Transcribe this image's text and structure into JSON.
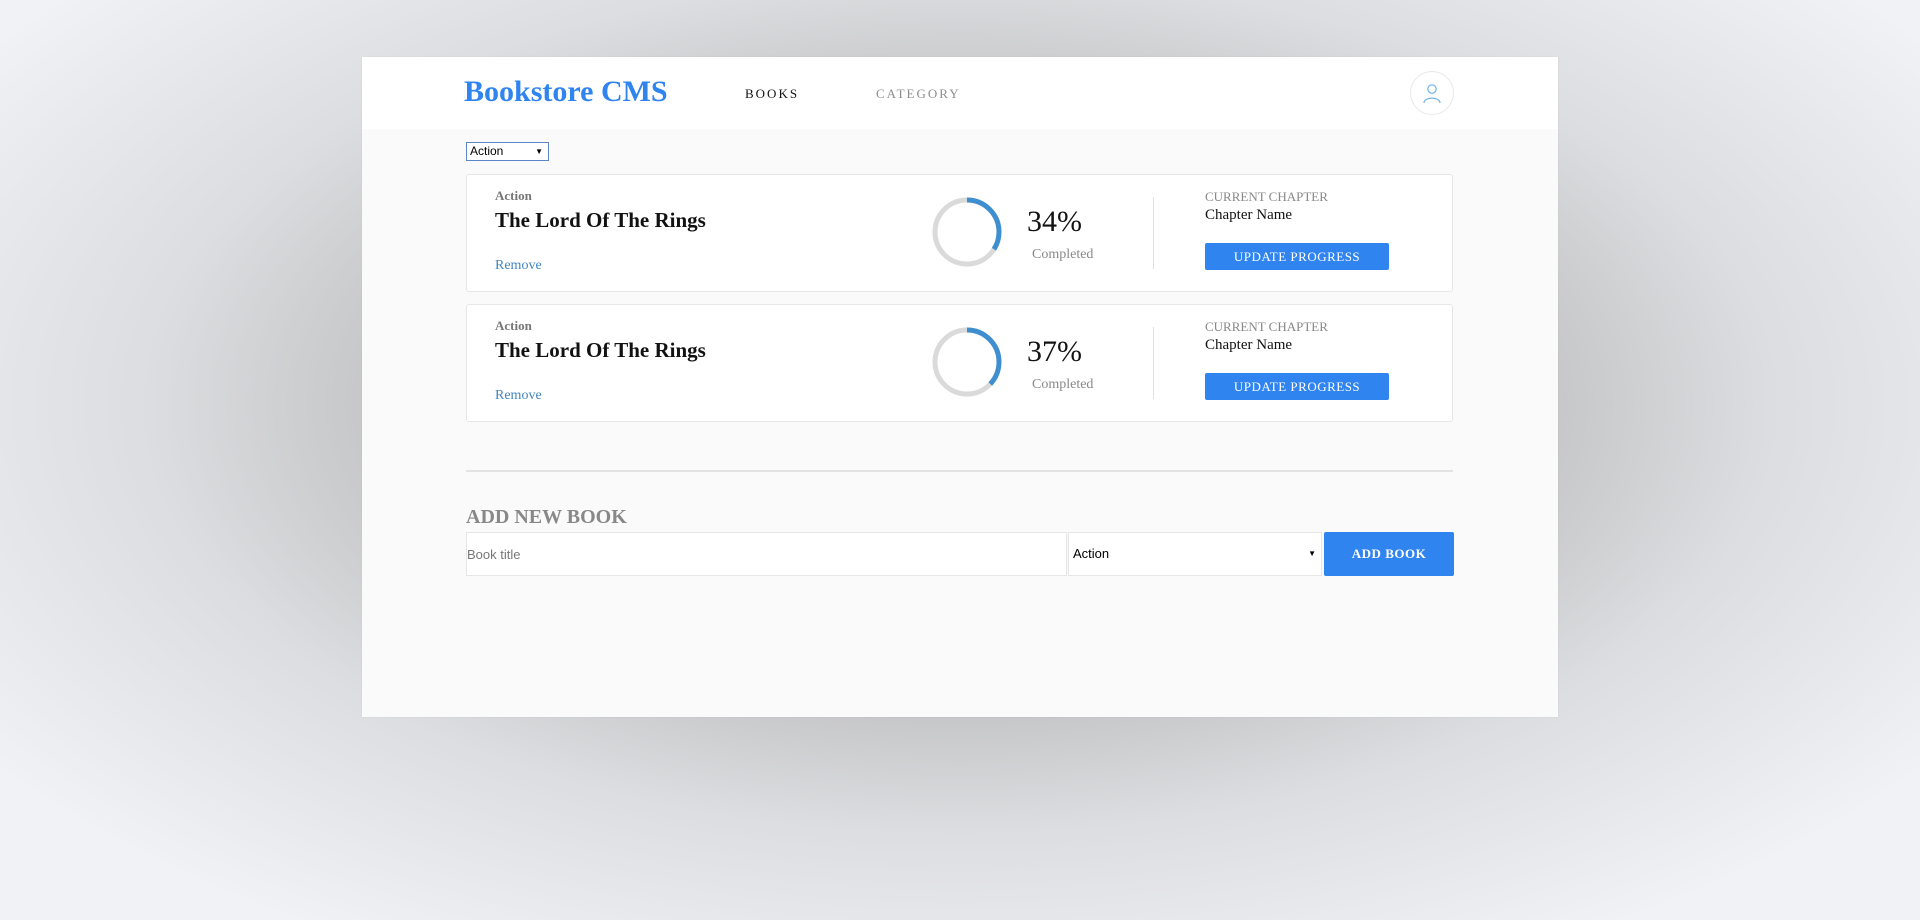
{
  "header": {
    "logo": "Bookstore CMS",
    "nav": [
      {
        "label": "BOOKS"
      },
      {
        "label": "CATEGORY"
      }
    ],
    "avatar_icon": "user-icon"
  },
  "filter": {
    "selected": "Action"
  },
  "books": [
    {
      "category": "Action",
      "title": "The Lord Of The Rings",
      "remove_label": "Remove",
      "progress": 34,
      "percent_text": "34%",
      "completed_label": "Completed",
      "chapter_label": "CURRENT CHAPTER",
      "chapter_name": "Chapter Name",
      "update_label": "UPDATE PROGRESS"
    },
    {
      "category": "Action",
      "title": "The Lord Of The Rings",
      "remove_label": "Remove",
      "progress": 37,
      "percent_text": "37%",
      "completed_label": "Completed",
      "chapter_label": "CURRENT CHAPTER",
      "chapter_name": "Chapter Name",
      "update_label": "UPDATE PROGRESS"
    }
  ],
  "add_form": {
    "heading": "ADD NEW BOOK",
    "title_placeholder": "Book title",
    "category_selected": "Action",
    "submit_label": "ADD BOOK"
  },
  "colors": {
    "accent": "#2f84f0",
    "progress": "#3f8fd0",
    "ring_track": "#dadada"
  }
}
